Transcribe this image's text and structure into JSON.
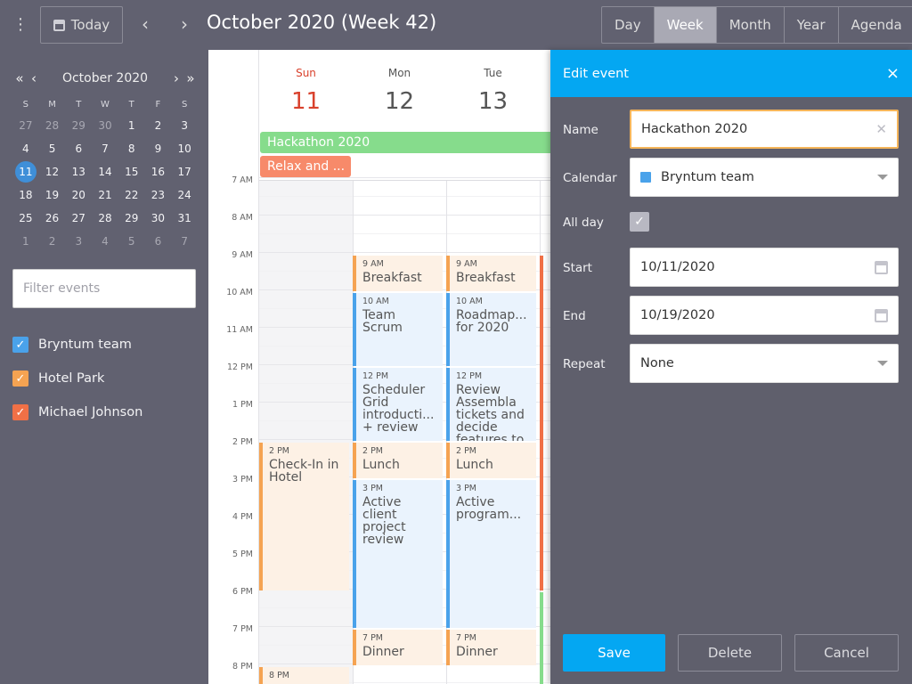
{
  "toolbar": {
    "menu_icon": "⋮",
    "today_label": "Today",
    "prev_icon": "‹",
    "next_icon": "›",
    "title": "October 2020 (Week 42)",
    "views": [
      "Day",
      "Week",
      "Month",
      "Year",
      "Agenda"
    ],
    "active_view": "Week"
  },
  "sidebar": {
    "month_label": "October 2020",
    "nav": {
      "prev_year": "«",
      "prev_month": "‹",
      "next_month": "›",
      "next_year": "»"
    },
    "weekdays": [
      "S",
      "M",
      "T",
      "W",
      "T",
      "F",
      "S"
    ],
    "weeks": [
      [
        "27",
        "28",
        "29",
        "30",
        "1",
        "2",
        "3"
      ],
      [
        "4",
        "5",
        "6",
        "7",
        "8",
        "9",
        "10"
      ],
      [
        "11",
        "12",
        "13",
        "14",
        "15",
        "16",
        "17"
      ],
      [
        "18",
        "19",
        "20",
        "21",
        "22",
        "23",
        "24"
      ],
      [
        "25",
        "26",
        "27",
        "28",
        "29",
        "30",
        "31"
      ],
      [
        "1",
        "2",
        "3",
        "4",
        "5",
        "6",
        "7"
      ]
    ],
    "selected_day": "11",
    "filter_placeholder": "Filter events",
    "calendars": [
      {
        "name": "Bryntum team",
        "color": "#4aa2ea",
        "checked": true
      },
      {
        "name": "Hotel Park",
        "color": "#f5a352",
        "checked": true
      },
      {
        "name": "Michael Johnson",
        "color": "#f07046",
        "checked": true
      }
    ]
  },
  "calendar": {
    "days": [
      {
        "name": "Sun",
        "num": "11"
      },
      {
        "name": "Mon",
        "num": "12"
      },
      {
        "name": "Tue",
        "num": "13"
      }
    ],
    "allday_events": [
      {
        "name": "Hackathon 2020",
        "color": "#86dc8c"
      },
      {
        "name": "Relax and ...",
        "color": "#f78a6a"
      }
    ],
    "hours": [
      "7 AM",
      "8 AM",
      "9 AM",
      "10 AM",
      "11 AM",
      "12 PM",
      "1 PM",
      "2 PM",
      "3 PM",
      "4 PM",
      "5 PM",
      "6 PM",
      "7 PM",
      "8 PM"
    ],
    "events": [
      {
        "time": "2 PM",
        "name": "Check-In in Hotel",
        "color": "orange"
      },
      {
        "time": "8 PM",
        "name": "",
        "color": "orange"
      },
      {
        "time": "9 AM",
        "name": "Breakfast",
        "color": "orange"
      },
      {
        "time": "10 AM",
        "name": "Team Scrum",
        "color": "blue"
      },
      {
        "time": "12 PM",
        "name": "Scheduler Grid introducti... + review",
        "color": "blue"
      },
      {
        "time": "2 PM",
        "name": "Lunch",
        "color": "orange"
      },
      {
        "time": "3 PM",
        "name": "Active client project review",
        "color": "blue"
      },
      {
        "time": "7 PM",
        "name": "Dinner",
        "color": "orange"
      },
      {
        "time": "9 AM",
        "name": "Breakfast",
        "color": "orange"
      },
      {
        "time": "10 AM",
        "name": "Roadmap... for 2020",
        "color": "blue"
      },
      {
        "time": "12 PM",
        "name": "Review Assembla tickets and decide features to",
        "color": "blue"
      },
      {
        "time": "2 PM",
        "name": "Lunch",
        "color": "orange"
      },
      {
        "time": "3 PM",
        "name": "Active program...",
        "color": "blue"
      },
      {
        "time": "7 PM",
        "name": "Dinner",
        "color": "orange"
      }
    ]
  },
  "editor": {
    "title": "Edit event",
    "close_icon": "×",
    "name_label": "Name",
    "name_value": "Hackathon 2020",
    "calendar_label": "Calendar",
    "calendar_value": "Bryntum team",
    "allday_label": "All day",
    "allday_checked": true,
    "start_label": "Start",
    "start_value": "10/11/2020",
    "end_label": "End",
    "end_value": "10/19/2020",
    "repeat_label": "Repeat",
    "repeat_value": "None",
    "save_label": "Save",
    "delete_label": "Delete",
    "cancel_label": "Cancel"
  }
}
